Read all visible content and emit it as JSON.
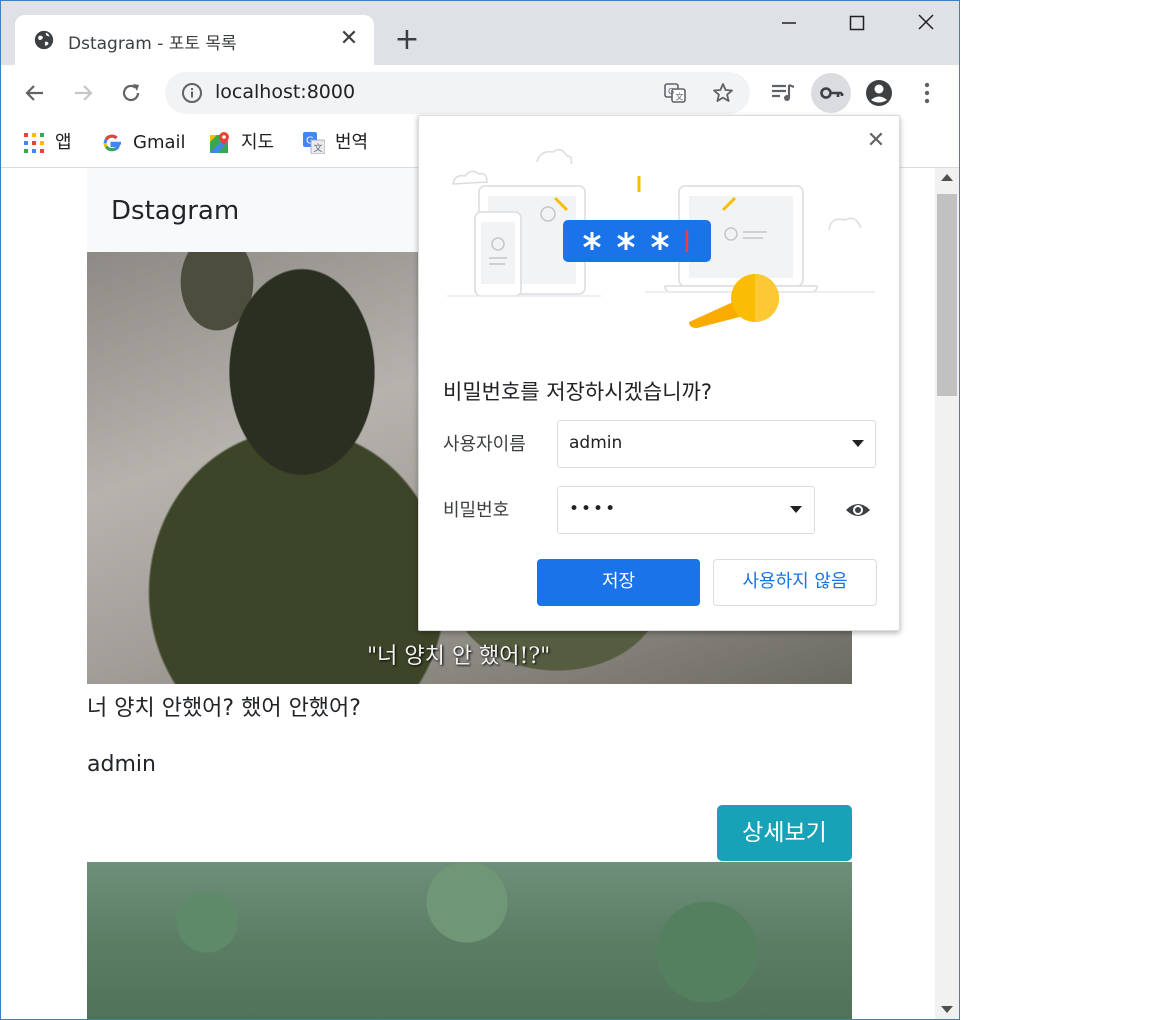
{
  "browser": {
    "tab_title": "Dstagram - 포토 목록",
    "tab_close": "✕",
    "new_tab": "+",
    "url": "localhost:8000",
    "bookmarks": [
      {
        "label": "앱",
        "icon": "apps-grid-icon"
      },
      {
        "label": "Gmail",
        "icon": "google-g-icon"
      },
      {
        "label": "지도",
        "icon": "maps-pin-icon"
      },
      {
        "label": "번역",
        "icon": "translate-icon"
      }
    ],
    "controls": {
      "minimize": "—",
      "maximize": "☐",
      "close": "✕"
    }
  },
  "page": {
    "brand": "Dstagram",
    "posts": [
      {
        "image_caption": "\"너 양치 안 했어!?\"",
        "text": "너 양치 안했어? 했어 안했어?",
        "author": "admin",
        "detail_button": "상세보기"
      }
    ]
  },
  "password_popup": {
    "close": "✕",
    "title": "비밀번호를 저장하시겠습니까?",
    "username_label": "사용자이름",
    "username_value": "admin",
    "password_label": "비밀번호",
    "password_value": "••••",
    "save_button": "저장",
    "never_button": "사용하지 않음"
  },
  "colors": {
    "accent": "#1a73e8",
    "detail_button": "#17a2b8",
    "navbar_bg": "#f8f9fa"
  }
}
